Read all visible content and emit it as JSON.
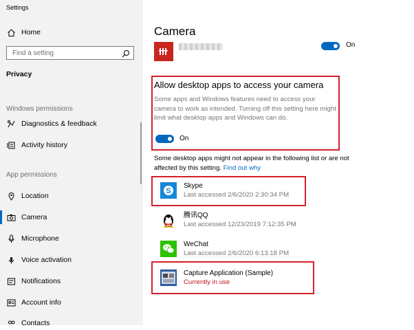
{
  "window": {
    "title": "Settings"
  },
  "sidebar": {
    "home_label": "Home",
    "search_placeholder": "Find a setting",
    "section_title": "Privacy",
    "windows_permissions_label": "Windows permissions",
    "windows_permissions_items": [
      {
        "label": "Diagnostics & feedback",
        "icon": "diagnostics-icon"
      },
      {
        "label": "Activity history",
        "icon": "activity-history-icon"
      }
    ],
    "app_permissions_label": "App permissions",
    "app_permissions_items": [
      {
        "label": "Location",
        "icon": "location-icon"
      },
      {
        "label": "Camera",
        "icon": "camera-icon",
        "selected": true
      },
      {
        "label": "Microphone",
        "icon": "microphone-icon"
      },
      {
        "label": "Voice activation",
        "icon": "voice-activation-icon"
      },
      {
        "label": "Notifications",
        "icon": "notifications-icon"
      },
      {
        "label": "Account info",
        "icon": "account-info-icon"
      },
      {
        "label": "Contacts",
        "icon": "contacts-icon"
      }
    ]
  },
  "main": {
    "title": "Camera",
    "top_toggle": {
      "state": "On"
    },
    "desktop_section": {
      "heading": "Allow desktop apps to access your camera",
      "description": "Some apps and Windows features need to access your camera to work as intended. Turning off this setting here might limit what desktop apps and Windows can do.",
      "toggle_state": "On",
      "note": "Some desktop apps might not appear in the following list or are not affected by this setting.",
      "link": "Find out why"
    },
    "apps": [
      {
        "name": "Skype",
        "status": "Last accessed 2/6/2020 2:30:34 PM",
        "icon": "skype-icon"
      },
      {
        "name": "腾讯QQ",
        "status": "Last accessed 12/23/2019 7:12:35 PM",
        "icon": "qq-icon"
      },
      {
        "name": "WeChat",
        "status": "Last accessed 2/6/2020 6:13:18 PM",
        "icon": "wechat-icon"
      },
      {
        "name": "Capture Application (Sample)",
        "status": "Currently in use",
        "icon": "capture-app-icon"
      }
    ]
  },
  "colors": {
    "accent": "#0067c0",
    "highlight_box": "#d4202a",
    "in_use": "#c50f1f"
  }
}
